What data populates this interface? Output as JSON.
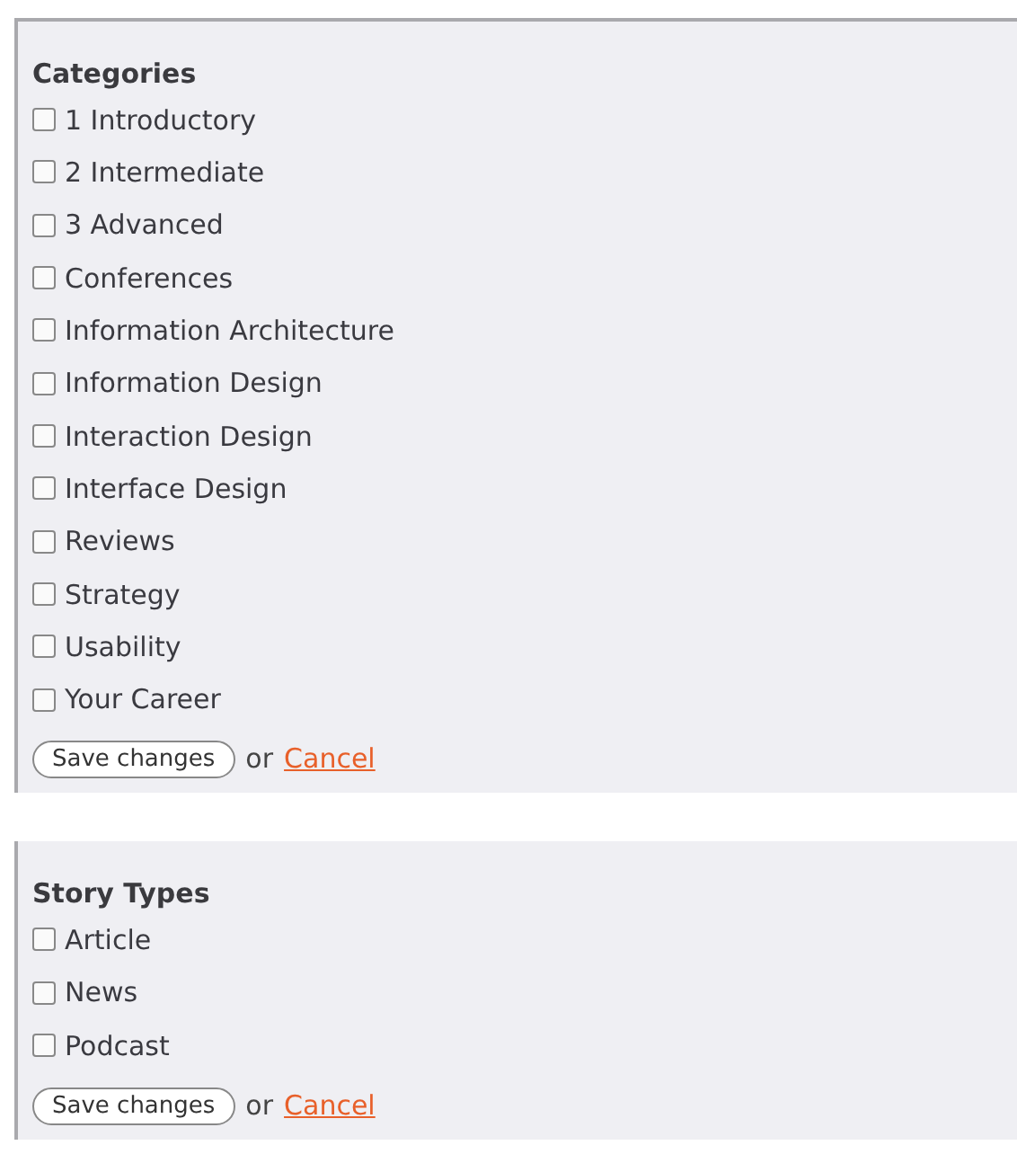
{
  "sections": [
    {
      "title": "Categories",
      "items": [
        {
          "label": "1 Introductory",
          "checked": false
        },
        {
          "label": "2 Intermediate",
          "checked": false
        },
        {
          "label": "3 Advanced",
          "checked": false
        },
        {
          "label": "Conferences",
          "checked": false
        },
        {
          "label": "Information Architecture",
          "checked": false
        },
        {
          "label": "Information Design",
          "checked": false
        },
        {
          "label": "Interaction Design",
          "checked": false
        },
        {
          "label": "Interface Design",
          "checked": false
        },
        {
          "label": "Reviews",
          "checked": false
        },
        {
          "label": "Strategy",
          "checked": false
        },
        {
          "label": "Usability",
          "checked": false
        },
        {
          "label": "Your Career",
          "checked": false
        }
      ],
      "save": "Save changes",
      "or": "or",
      "cancel": "Cancel"
    },
    {
      "title": "Story Types",
      "items": [
        {
          "label": "Article",
          "checked": false
        },
        {
          "label": "News",
          "checked": false
        },
        {
          "label": "Podcast",
          "checked": false
        }
      ],
      "save": "Save changes",
      "or": "or",
      "cancel": "Cancel"
    }
  ]
}
